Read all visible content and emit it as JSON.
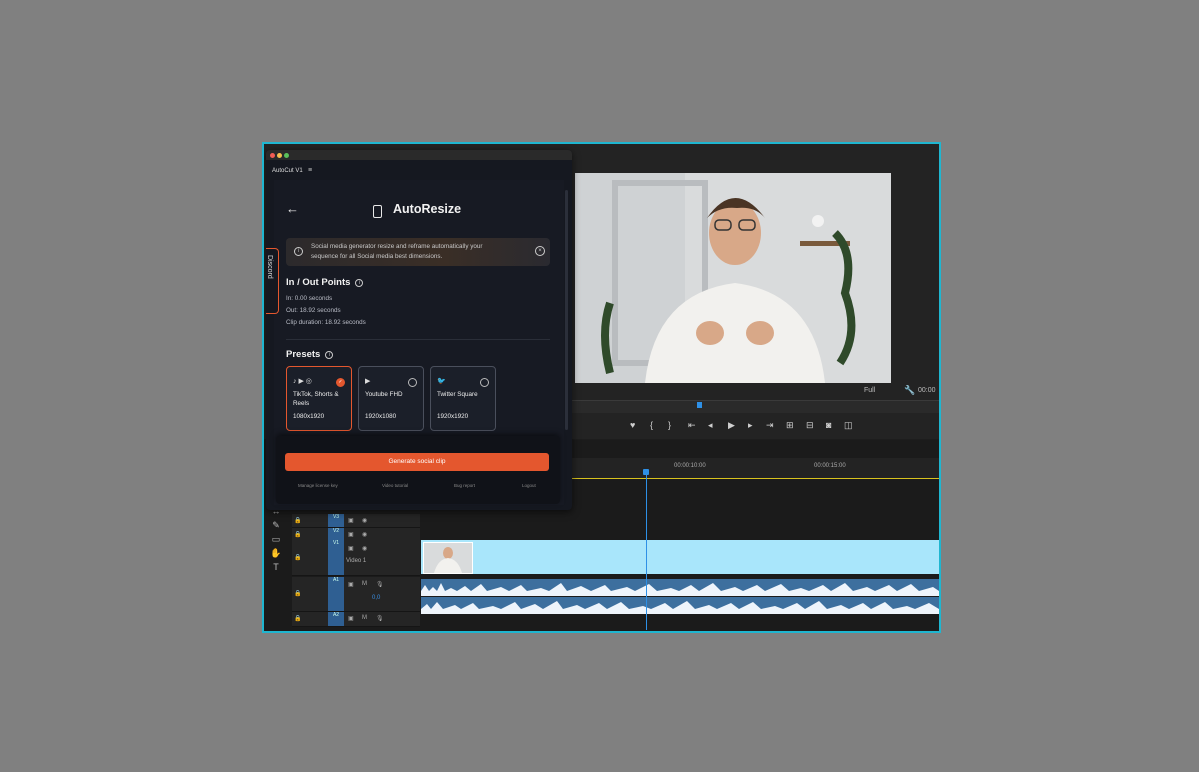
{
  "plugin": {
    "app_name": "AutoCut V1",
    "menu_icon": "hamburger-icon",
    "title": "AutoResize",
    "info_banner": "Social media generator resize and reframe automatically your sequence for all Social media best dimensions.",
    "inout": {
      "heading": "In / Out Points",
      "in": "In: 0.00 seconds",
      "out": "Out: 18.92 seconds",
      "duration": "Clip duration: 18.92 seconds"
    },
    "presets": {
      "heading": "Presets",
      "items": [
        {
          "name": "TikTok, Shorts & Reels",
          "dims": "1080x1920",
          "selected": true
        },
        {
          "name": "Youtube FHD",
          "dims": "1920x1080",
          "selected": false
        },
        {
          "name": "Twitter Square",
          "dims": "1920x1920",
          "selected": false
        }
      ]
    },
    "generate_label": "Generate social clip",
    "links": [
      "Manage license key",
      "Video tutorial",
      "Bug report",
      "Logout"
    ],
    "discord_label": "Discord",
    "accent": "#e4572e"
  },
  "monitor": {
    "zoom": "Full",
    "timecode": "00:00"
  },
  "timeline": {
    "ruler": [
      "00:00:10:00",
      "00:00:15:00"
    ],
    "tracks": [
      {
        "label": "V3"
      },
      {
        "label": "V2"
      },
      {
        "label": "V1",
        "name": "Video 1"
      },
      {
        "label": "A1",
        "level": "0,0"
      },
      {
        "label": "A2"
      }
    ]
  }
}
